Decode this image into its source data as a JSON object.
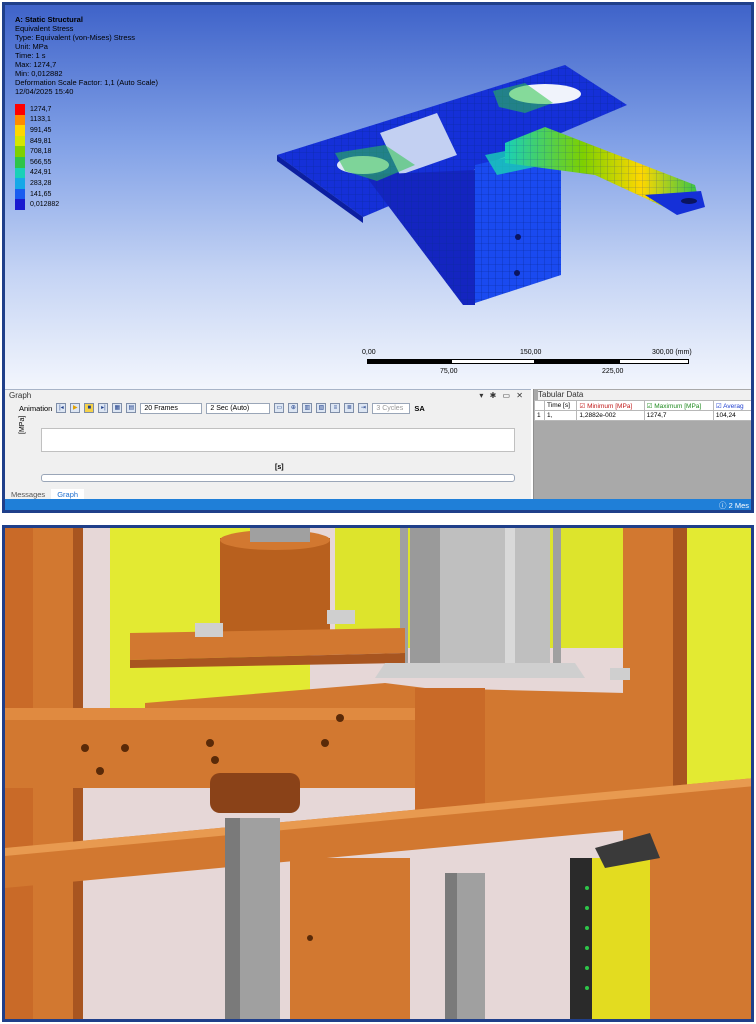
{
  "analysis": {
    "title": "A: Static Structural",
    "result_type": "Equivalent Stress",
    "type_line": "Type: Equivalent (von-Mises) Stress",
    "unit_line": "Unit: MPa",
    "time_line": "Time: 1 s",
    "max_line": "Max: 1274,7",
    "min_line": "Min: 0,012882",
    "scale_line": "Deformation Scale Factor: 1,1 (Auto Scale)",
    "date_line": "12/04/2025 15:40"
  },
  "legend": {
    "values": [
      "1274,7",
      "1133,1",
      "991,45",
      "849,81",
      "708,18",
      "566,55",
      "424,91",
      "283,28",
      "141,65",
      "0,012882"
    ],
    "colors": [
      "#ff0000",
      "#ff8c00",
      "#ffd700",
      "#d4e600",
      "#7ed000",
      "#2ec44a",
      "#19d0b8",
      "#16a8e8",
      "#1a5cf0",
      "#1a1ad0"
    ]
  },
  "scale_bar": {
    "top_labels": [
      "0,00",
      "150,00",
      "300,00 (mm)"
    ],
    "bottom_labels": [
      "75,00",
      "225,00"
    ]
  },
  "graph": {
    "title": "Graph",
    "controls": "▾ ✱ ▭ ✕",
    "animation_label": "Animation",
    "frames": "20 Frames",
    "duration": "2 Sec (Auto)",
    "cycles": "3 Cycles",
    "sa": "SA",
    "ylabel": "[MPa]",
    "xlabel": "[s]",
    "tabs": [
      "Messages",
      "Graph"
    ]
  },
  "tabular": {
    "title": "Tabular Data",
    "headers": [
      "",
      "Time [s]",
      "Minimum [MPa]",
      "Maximum [MPa]",
      "Averag"
    ],
    "row": [
      "1",
      "1,",
      "1,2882e-002",
      "1274,7",
      "104,24"
    ]
  },
  "status": {
    "message": "2 Mes"
  }
}
